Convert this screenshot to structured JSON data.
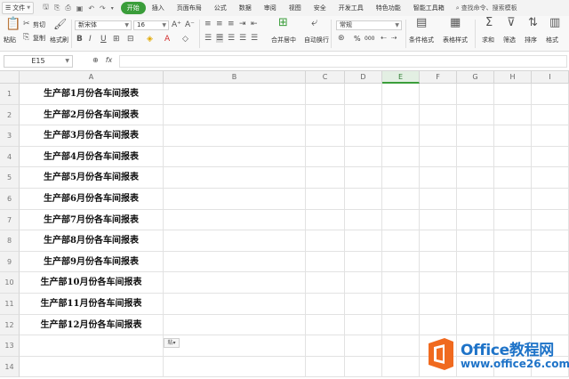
{
  "menubar": {
    "file_label": "文件",
    "tabs": [
      "开始",
      "插入",
      "页面布局",
      "公式",
      "数据",
      "审阅",
      "视图",
      "安全",
      "开发工具",
      "特色功能",
      "智能工具箱"
    ],
    "active_tab": "开始",
    "search_label": "查找命令、搜索模板"
  },
  "ribbon": {
    "paste_label": "粘贴",
    "cut_label": "剪切",
    "copy_label": "复制",
    "format_painter_label": "格式刷",
    "font_name": "新宋体",
    "font_size": "16",
    "merge_center_label": "合并居中",
    "wrap_label": "自动换行",
    "number_format": "常规",
    "conditional_format_label": "条件格式",
    "table_style_label": "表格样式",
    "sum_label": "求和",
    "filter_label": "筛选",
    "sort_label": "排序",
    "format_label": "格式",
    "percent_symbol": "%",
    "thousands_symbol": "000"
  },
  "formulabar": {
    "cell_ref": "E15",
    "fx_label": "fx",
    "value": ""
  },
  "grid": {
    "columns": [
      "A",
      "B",
      "C",
      "D",
      "E",
      "F",
      "G",
      "H",
      "I"
    ],
    "selected_column": "E",
    "row_numbers": [
      "1",
      "2",
      "3",
      "4",
      "5",
      "6",
      "7",
      "8",
      "9",
      "10",
      "11",
      "12",
      "13",
      "14"
    ],
    "a_values": [
      "生产部1月份各车间报表",
      "生产部2月份各车间报表",
      "生产部3月份各车间报表",
      "生产部4月份各车间报表",
      "生产部5月份各车间报表",
      "生产部6月份各车间报表",
      "生产部7月份各车间报表",
      "生产部8月份各车间报表",
      "生产部9月份各车间报表",
      "生产部10月份各车间报表",
      "生产部11月份各车间报表",
      "生产部12月份各车间报表"
    ],
    "paste_option_label": "粘"
  },
  "watermark": {
    "title": "Office教程网",
    "url": "www.office26.com",
    "logo_color": "#f06a1f",
    "text_color": "#1e73c8"
  },
  "colors": {
    "accent": "#3a9d3a",
    "header_bg": "#f2f2f2",
    "grid_line": "#e2e2e2"
  }
}
